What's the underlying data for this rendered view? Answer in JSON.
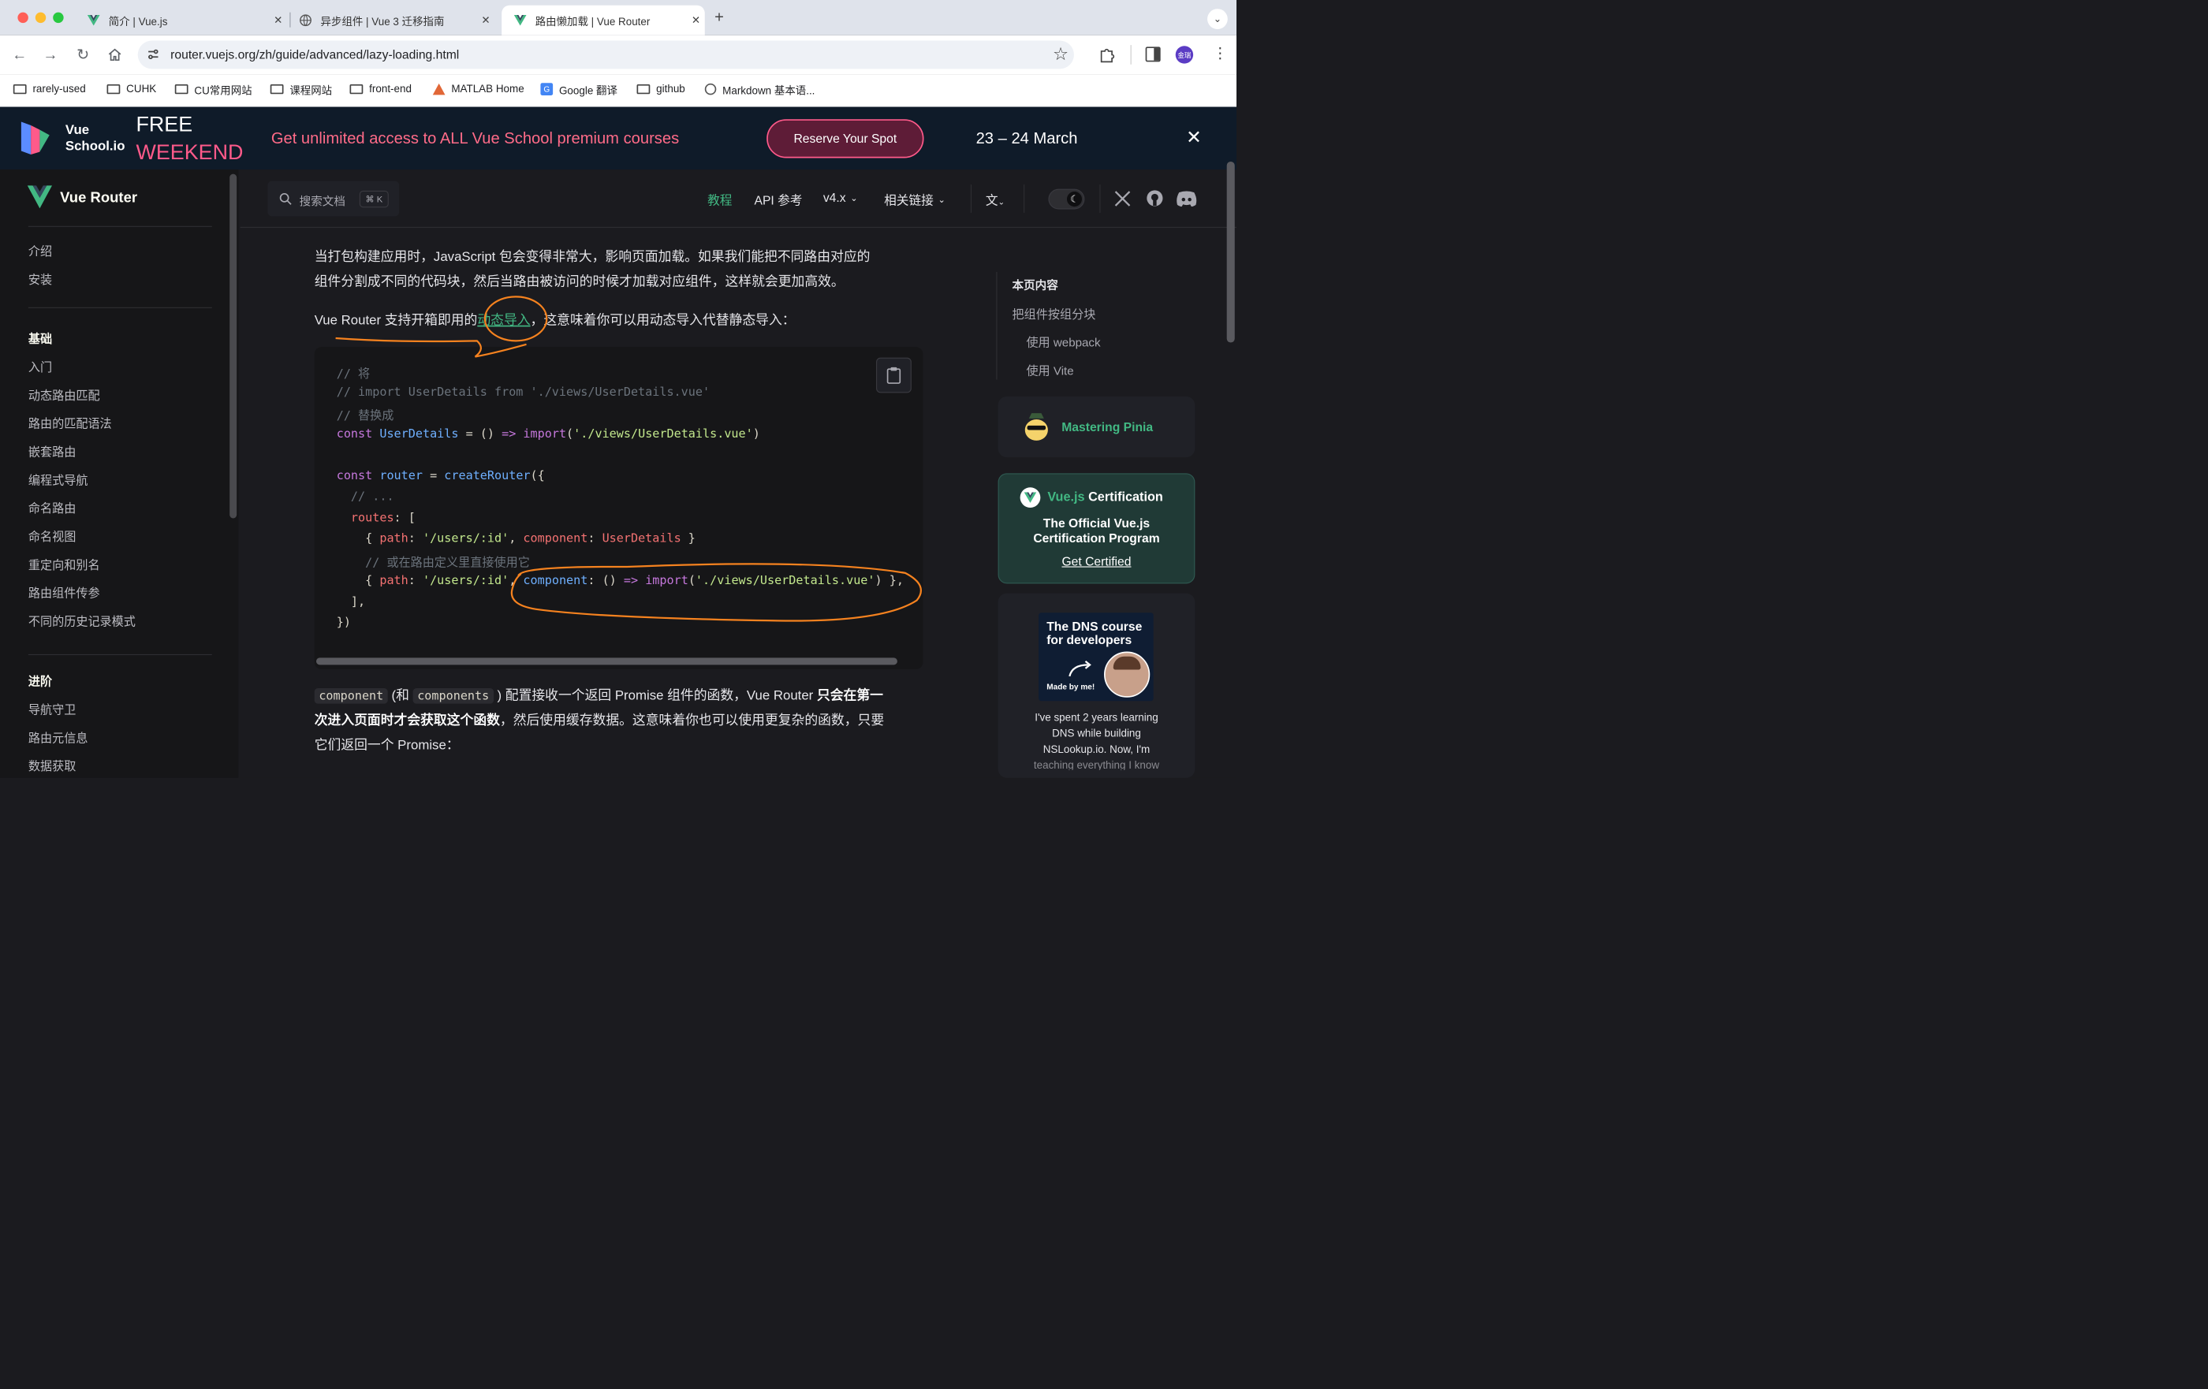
{
  "browser": {
    "tabs": [
      {
        "title": "简介 | Vue.js",
        "active": false
      },
      {
        "title": "异步组件 | Vue 3 迁移指南",
        "active": false
      },
      {
        "title": "路由懒加载 | Vue Router",
        "active": true
      }
    ],
    "url": "router.vuejs.org/zh/guide/advanced/lazy-loading.html",
    "profile_initials": "金瑞",
    "bookmarks": [
      "rarely-used",
      "CUHK",
      "CU常用网站",
      "课程网站",
      "front-end",
      "MATLAB Home",
      "Google 翻译",
      "github",
      "Markdown 基本语..."
    ]
  },
  "banner": {
    "brand_line1": "Vue",
    "brand_line2": "School.io",
    "free": "FREE",
    "weekend": "WEEKEND",
    "headline": "Get unlimited access to ALL Vue School premium courses",
    "cta": "Reserve Your Spot",
    "dates": "23 – 24 March"
  },
  "nav": {
    "site_title": "Vue Router",
    "search_placeholder": "搜索文档",
    "search_shortcut": "⌘ K",
    "links": [
      "教程",
      "API 参考",
      "v4.x",
      "相关链接"
    ]
  },
  "sidebar": {
    "intro_items": [
      "介绍",
      "安装"
    ],
    "basics_title": "基础",
    "basics_items": [
      "入门",
      "动态路由匹配",
      "路由的匹配语法",
      "嵌套路由",
      "编程式导航",
      "命名路由",
      "命名视图",
      "重定向和别名",
      "路由组件传参",
      "不同的历史记录模式"
    ],
    "advanced_title": "进阶",
    "advanced_items": [
      "导航守卫",
      "路由元信息",
      "数据获取"
    ]
  },
  "content": {
    "para1_line1": "当打包构建应用时，JavaScript 包会变得非常大，影响页面加载。如果我们能把不同路由对应的",
    "para1_line2": "组件分割成不同的代码块，然后当路由被访问的时候才加载对应组件，这样就会更加高效。",
    "para2_before": "Vue Router 支持开箱即用的",
    "para2_link": "动态导入",
    "para2_after": "，这意味着你可以用动态导入代替静态导入：",
    "code": [
      [
        [
          "cm",
          "// 将"
        ]
      ],
      [
        [
          "cm",
          "// import UserDetails from './views/UserDetails.vue'"
        ]
      ],
      [
        [
          "cm",
          "// 替换成"
        ]
      ],
      [
        [
          "kw",
          "const "
        ],
        [
          "fn",
          "UserDetails"
        ],
        [
          "pl",
          " = () "
        ],
        [
          "kw",
          "=>"
        ],
        [
          "pl",
          " "
        ],
        [
          "kw",
          "import"
        ],
        [
          "pl",
          "("
        ],
        [
          "str",
          "'./views/UserDetails.vue'"
        ],
        [
          "pl",
          ")"
        ]
      ],
      [],
      [
        [
          "kw",
          "const "
        ],
        [
          "fn",
          "router"
        ],
        [
          "pl",
          " = "
        ],
        [
          "fn",
          "createRouter"
        ],
        [
          "pl",
          "({"
        ]
      ],
      [
        [
          "cm",
          "  // ..."
        ]
      ],
      [
        [
          "key",
          "  routes"
        ],
        [
          "pl",
          ": ["
        ]
      ],
      [
        [
          "pl",
          "    { "
        ],
        [
          "key",
          "path"
        ],
        [
          "pl",
          ": "
        ],
        [
          "str",
          "'/users/:id'"
        ],
        [
          "pl",
          ", "
        ],
        [
          "key",
          "component"
        ],
        [
          "pl",
          ": "
        ],
        [
          "key",
          "UserDetails"
        ],
        [
          "pl",
          " }"
        ]
      ],
      [
        [
          "cm",
          "    // 或在路由定义里直接使用它"
        ]
      ],
      [
        [
          "pl",
          "    { "
        ],
        [
          "key",
          "path"
        ],
        [
          "pl",
          ": "
        ],
        [
          "str",
          "'/users/:id'"
        ],
        [
          "pl",
          ", "
        ],
        [
          "fn",
          "component"
        ],
        [
          "pl",
          ": () "
        ],
        [
          "kw",
          "=>"
        ],
        [
          "pl",
          " "
        ],
        [
          "kw",
          "import"
        ],
        [
          "pl",
          "("
        ],
        [
          "str",
          "'./views/UserDetails.vue'"
        ],
        [
          "pl",
          ") },"
        ]
      ],
      [
        [
          "pl",
          "  ],"
        ]
      ],
      [
        [
          "pl",
          "})"
        ]
      ]
    ],
    "chip1": "component",
    "para3_a": "(和",
    "chip2": "components",
    "para3_b": ") 配置接收一个返回 Promise 组件的函数，Vue Router",
    "para3_bold1": "只会在第一",
    "para3_bold2": "次进入页面时才会获取这个函数",
    "para3_c": "，然后使用缓存数据。这意味着你也可以使用更复杂的函数，只要",
    "para3_d": "它们返回一个 Promise："
  },
  "toc": {
    "title": "本页内容",
    "items": [
      "把组件按组分块",
      "使用 webpack",
      "使用 Vite"
    ]
  },
  "ads": {
    "pinia": "Mastering Pinia",
    "cert_brand": "Vue.js",
    "cert_word": "Certification",
    "cert_line1": "The Official Vue.js",
    "cert_line2": "Certification Program",
    "cert_link": "Get Certified",
    "dns_title1": "The DNS course",
    "dns_title2": "for developers",
    "dns_made": "Made by me!",
    "dns_text1": "I've spent 2 years learning",
    "dns_text2": "DNS while building",
    "dns_text3": "NSLookup.io. Now, I'm",
    "dns_text4": "teaching everything I know"
  },
  "colors": {
    "accent": "#42b883",
    "annotation": "#f5821f",
    "banner_pink": "#ff5a8a"
  }
}
